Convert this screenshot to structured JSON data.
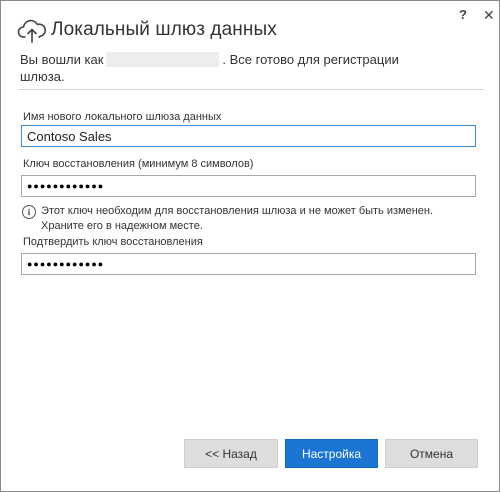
{
  "window": {
    "title": "Локальный шлюз данных",
    "help_label": "?",
    "close_label": "✕"
  },
  "intro": {
    "prefix": "Вы вошли как",
    "suffix": ". Все готово для регистрации шлюза."
  },
  "form": {
    "gateway_name_label": "Имя нового локального шлюза данных",
    "gateway_name_value": "Contoso Sales",
    "recovery_key_label": "Ключ восстановления (минимум 8 символов)",
    "recovery_key_value": "●●●●●●●●●●●●",
    "info_line1": "Этот ключ необходим для восстановления шлюза и не может быть изменен.",
    "info_line2": "Храните его в надежном месте.",
    "confirm_key_label": "Подтвердить ключ восстановления",
    "confirm_key_value": "●●●●●●●●●●●●"
  },
  "buttons": {
    "back": "<< Назад",
    "configure": "Настройка",
    "cancel": "Отмена"
  },
  "colors": {
    "primary": "#1a76d2",
    "secondary_button": "#dddddd",
    "focus_border": "#3c8ad8"
  },
  "icons": {
    "title": "cloud-upload-icon",
    "info": "info-icon"
  }
}
